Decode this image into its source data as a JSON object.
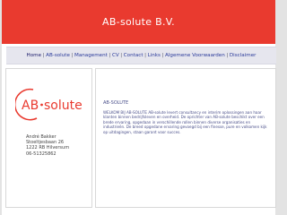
{
  "header": {
    "title": "AB-solute B.V.",
    "color": "#e93a2f"
  },
  "nav": {
    "items": [
      {
        "label": "Home"
      },
      {
        "label": "AB-solute"
      },
      {
        "label": "Management"
      },
      {
        "label": "CV"
      },
      {
        "label": "Contact"
      },
      {
        "label": "Links"
      },
      {
        "label": "Algemene Voorwaarden"
      },
      {
        "label": "Disclaimer"
      }
    ],
    "separator": "|"
  },
  "sidebar": {
    "logo": {
      "part1": "AB",
      "part2": "solute",
      "color": "#e93a2f"
    },
    "address": {
      "name": "André Bakker",
      "street": "Stoeltjesbaan 26",
      "city": "1222 RB Hilversum",
      "phone": "06-51325862"
    }
  },
  "content": {
    "title": "AB-SOLUTE",
    "paragraph": "WELKOM BIJ AB-SOLUTE AB-solute levert consultancy en interim oplossingen aan haar klanten binnen bedrijfsleven en overheid. De oprichter van AB-solute beschikt over een brede ervaring, opgedaan in verschillende rollen binnen diverse organisaties en industrieën. De breed opgedane ervaring gevoegd bij een finesse, pure en volkomen kijk op uitdagingen, staan garant voor succes."
  }
}
